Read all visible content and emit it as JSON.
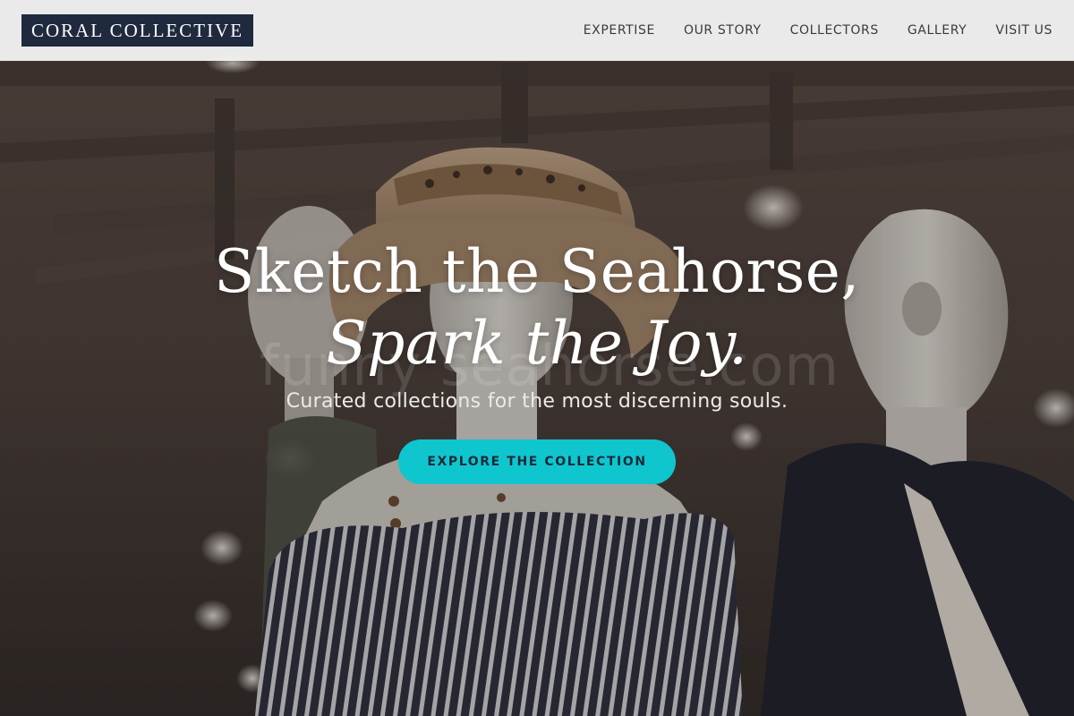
{
  "brand": {
    "name": "CORAL COLLECTIVE"
  },
  "nav": {
    "items": [
      "EXPERTISE",
      "OUR STORY",
      "COLLECTORS",
      "GALLERY",
      "VISIT US"
    ]
  },
  "hero": {
    "title_line1": "Sketch the Seahorse,",
    "title_line2": "Spark the Joy.",
    "subtitle": "Curated collections for the most discerning souls.",
    "cta_label": "EXPLORE THE COLLECTION",
    "watermark": "funny seahorse.com",
    "background_image": "mannequins-boutique-display"
  },
  "colors": {
    "header_bg": "#f1f1f1",
    "logo_bg": "#1f2a3e",
    "accent": "#0fc6cf",
    "text_dark": "#3b3b3b"
  }
}
